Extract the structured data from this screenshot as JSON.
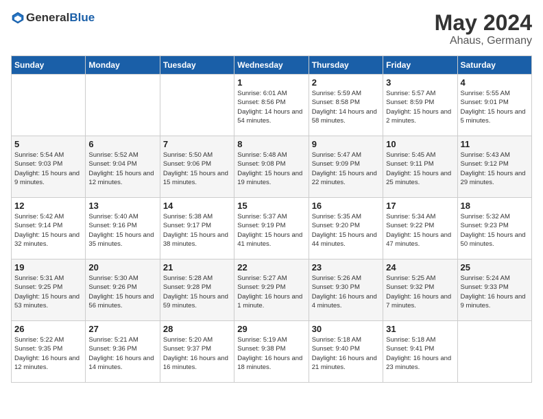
{
  "header": {
    "logo_general": "General",
    "logo_blue": "Blue",
    "month": "May 2024",
    "location": "Ahaus, Germany"
  },
  "days_of_week": [
    "Sunday",
    "Monday",
    "Tuesday",
    "Wednesday",
    "Thursday",
    "Friday",
    "Saturday"
  ],
  "weeks": [
    [
      {
        "day": "",
        "sunrise": "",
        "sunset": "",
        "daylight": ""
      },
      {
        "day": "",
        "sunrise": "",
        "sunset": "",
        "daylight": ""
      },
      {
        "day": "",
        "sunrise": "",
        "sunset": "",
        "daylight": ""
      },
      {
        "day": "1",
        "sunrise": "Sunrise: 6:01 AM",
        "sunset": "Sunset: 8:56 PM",
        "daylight": "Daylight: 14 hours and 54 minutes."
      },
      {
        "day": "2",
        "sunrise": "Sunrise: 5:59 AM",
        "sunset": "Sunset: 8:58 PM",
        "daylight": "Daylight: 14 hours and 58 minutes."
      },
      {
        "day": "3",
        "sunrise": "Sunrise: 5:57 AM",
        "sunset": "Sunset: 8:59 PM",
        "daylight": "Daylight: 15 hours and 2 minutes."
      },
      {
        "day": "4",
        "sunrise": "Sunrise: 5:55 AM",
        "sunset": "Sunset: 9:01 PM",
        "daylight": "Daylight: 15 hours and 5 minutes."
      }
    ],
    [
      {
        "day": "5",
        "sunrise": "Sunrise: 5:54 AM",
        "sunset": "Sunset: 9:03 PM",
        "daylight": "Daylight: 15 hours and 9 minutes."
      },
      {
        "day": "6",
        "sunrise": "Sunrise: 5:52 AM",
        "sunset": "Sunset: 9:04 PM",
        "daylight": "Daylight: 15 hours and 12 minutes."
      },
      {
        "day": "7",
        "sunrise": "Sunrise: 5:50 AM",
        "sunset": "Sunset: 9:06 PM",
        "daylight": "Daylight: 15 hours and 15 minutes."
      },
      {
        "day": "8",
        "sunrise": "Sunrise: 5:48 AM",
        "sunset": "Sunset: 9:08 PM",
        "daylight": "Daylight: 15 hours and 19 minutes."
      },
      {
        "day": "9",
        "sunrise": "Sunrise: 5:47 AM",
        "sunset": "Sunset: 9:09 PM",
        "daylight": "Daylight: 15 hours and 22 minutes."
      },
      {
        "day": "10",
        "sunrise": "Sunrise: 5:45 AM",
        "sunset": "Sunset: 9:11 PM",
        "daylight": "Daylight: 15 hours and 25 minutes."
      },
      {
        "day": "11",
        "sunrise": "Sunrise: 5:43 AM",
        "sunset": "Sunset: 9:12 PM",
        "daylight": "Daylight: 15 hours and 29 minutes."
      }
    ],
    [
      {
        "day": "12",
        "sunrise": "Sunrise: 5:42 AM",
        "sunset": "Sunset: 9:14 PM",
        "daylight": "Daylight: 15 hours and 32 minutes."
      },
      {
        "day": "13",
        "sunrise": "Sunrise: 5:40 AM",
        "sunset": "Sunset: 9:16 PM",
        "daylight": "Daylight: 15 hours and 35 minutes."
      },
      {
        "day": "14",
        "sunrise": "Sunrise: 5:38 AM",
        "sunset": "Sunset: 9:17 PM",
        "daylight": "Daylight: 15 hours and 38 minutes."
      },
      {
        "day": "15",
        "sunrise": "Sunrise: 5:37 AM",
        "sunset": "Sunset: 9:19 PM",
        "daylight": "Daylight: 15 hours and 41 minutes."
      },
      {
        "day": "16",
        "sunrise": "Sunrise: 5:35 AM",
        "sunset": "Sunset: 9:20 PM",
        "daylight": "Daylight: 15 hours and 44 minutes."
      },
      {
        "day": "17",
        "sunrise": "Sunrise: 5:34 AM",
        "sunset": "Sunset: 9:22 PM",
        "daylight": "Daylight: 15 hours and 47 minutes."
      },
      {
        "day": "18",
        "sunrise": "Sunrise: 5:32 AM",
        "sunset": "Sunset: 9:23 PM",
        "daylight": "Daylight: 15 hours and 50 minutes."
      }
    ],
    [
      {
        "day": "19",
        "sunrise": "Sunrise: 5:31 AM",
        "sunset": "Sunset: 9:25 PM",
        "daylight": "Daylight: 15 hours and 53 minutes."
      },
      {
        "day": "20",
        "sunrise": "Sunrise: 5:30 AM",
        "sunset": "Sunset: 9:26 PM",
        "daylight": "Daylight: 15 hours and 56 minutes."
      },
      {
        "day": "21",
        "sunrise": "Sunrise: 5:28 AM",
        "sunset": "Sunset: 9:28 PM",
        "daylight": "Daylight: 15 hours and 59 minutes."
      },
      {
        "day": "22",
        "sunrise": "Sunrise: 5:27 AM",
        "sunset": "Sunset: 9:29 PM",
        "daylight": "Daylight: 16 hours and 1 minute."
      },
      {
        "day": "23",
        "sunrise": "Sunrise: 5:26 AM",
        "sunset": "Sunset: 9:30 PM",
        "daylight": "Daylight: 16 hours and 4 minutes."
      },
      {
        "day": "24",
        "sunrise": "Sunrise: 5:25 AM",
        "sunset": "Sunset: 9:32 PM",
        "daylight": "Daylight: 16 hours and 7 minutes."
      },
      {
        "day": "25",
        "sunrise": "Sunrise: 5:24 AM",
        "sunset": "Sunset: 9:33 PM",
        "daylight": "Daylight: 16 hours and 9 minutes."
      }
    ],
    [
      {
        "day": "26",
        "sunrise": "Sunrise: 5:22 AM",
        "sunset": "Sunset: 9:35 PM",
        "daylight": "Daylight: 16 hours and 12 minutes."
      },
      {
        "day": "27",
        "sunrise": "Sunrise: 5:21 AM",
        "sunset": "Sunset: 9:36 PM",
        "daylight": "Daylight: 16 hours and 14 minutes."
      },
      {
        "day": "28",
        "sunrise": "Sunrise: 5:20 AM",
        "sunset": "Sunset: 9:37 PM",
        "daylight": "Daylight: 16 hours and 16 minutes."
      },
      {
        "day": "29",
        "sunrise": "Sunrise: 5:19 AM",
        "sunset": "Sunset: 9:38 PM",
        "daylight": "Daylight: 16 hours and 18 minutes."
      },
      {
        "day": "30",
        "sunrise": "Sunrise: 5:18 AM",
        "sunset": "Sunset: 9:40 PM",
        "daylight": "Daylight: 16 hours and 21 minutes."
      },
      {
        "day": "31",
        "sunrise": "Sunrise: 5:18 AM",
        "sunset": "Sunset: 9:41 PM",
        "daylight": "Daylight: 16 hours and 23 minutes."
      },
      {
        "day": "",
        "sunrise": "",
        "sunset": "",
        "daylight": ""
      }
    ]
  ]
}
